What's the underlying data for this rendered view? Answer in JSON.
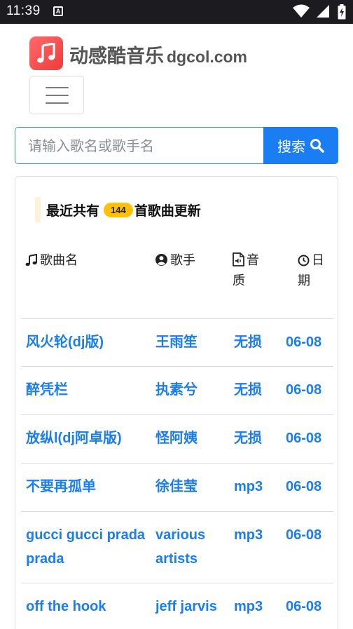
{
  "status_bar": {
    "time": "11:39",
    "notification_glyph": "A"
  },
  "header": {
    "site_name": "动感酷音乐",
    "site_domain": "dgcol.com"
  },
  "search": {
    "placeholder": "请输入歌名或歌手名",
    "button_label": "搜索"
  },
  "list": {
    "heading_before": "最近共有",
    "count": "144",
    "heading_after": "首歌曲更新",
    "columns": {
      "song": "歌曲名",
      "artist": "歌手",
      "quality": "音质",
      "date": "日期"
    },
    "rows": [
      {
        "song": "风火轮(dj版)",
        "artist": "王雨笙",
        "quality": "无损",
        "date": "06-08"
      },
      {
        "song": "醉凭栏",
        "artist": "执素兮",
        "quality": "无损",
        "date": "06-08"
      },
      {
        "song": "放纵l(dj阿卓版)",
        "artist": "怪阿姨",
        "quality": "无损",
        "date": "06-08"
      },
      {
        "song": "不要再孤单",
        "artist": "徐佳莹",
        "quality": "mp3",
        "date": "06-08"
      },
      {
        "song": "gucci gucci prada prada",
        "artist": "various artists",
        "quality": "mp3",
        "date": "06-08"
      },
      {
        "song": "off the hook",
        "artist": "jeff jarvis",
        "quality": "mp3",
        "date": "06-08"
      }
    ]
  },
  "colors": {
    "accent": "#1a7ef2",
    "badge": "#ffc107",
    "logo": "#ee3b3b",
    "status_bar": "#1b1b20"
  }
}
